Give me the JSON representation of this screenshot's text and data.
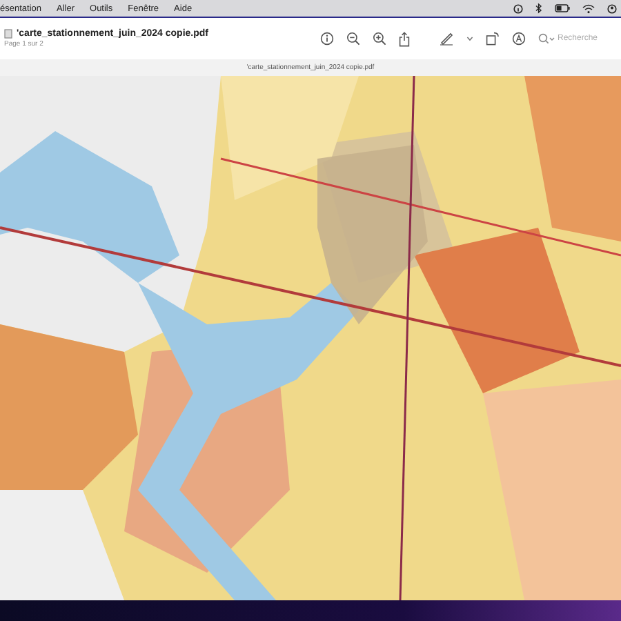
{
  "menu_bar": {
    "items": [
      "ésentation",
      "Aller",
      "Outils",
      "Fenêtre",
      "Aide"
    ]
  },
  "window": {
    "title": "'carte_stationnement_juin_2024 copie.pdf",
    "subtitle": "Page 1 sur 2",
    "search": {
      "placeholder": "Recherche"
    }
  },
  "document": {
    "title": "'carte_stationnement_juin_2024 copie.pdf"
  }
}
